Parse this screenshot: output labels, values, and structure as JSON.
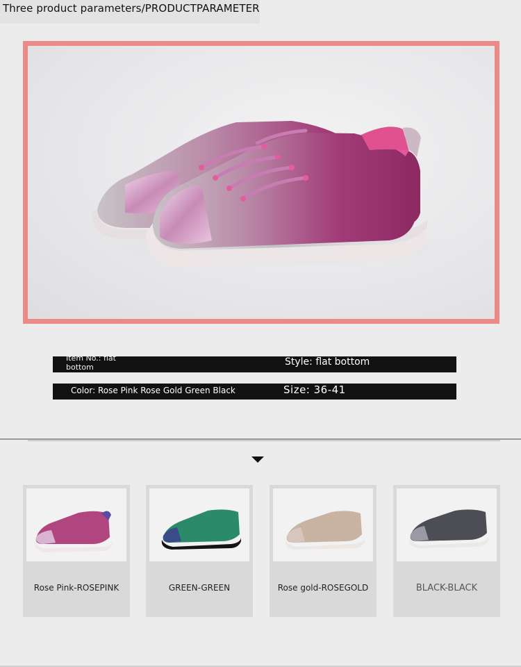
{
  "header": {
    "title": "Three product parameters/PRODUCTPARAMETER"
  },
  "hero": {
    "image_alt": "Rose pink glitter lace-up sneaker",
    "frame_color": "#ec8a89"
  },
  "parameters": {
    "item_no": "Item No.: flat bottom",
    "style": "Style: flat bottom",
    "color": "Color: Rose Pink Rose Gold Green Black",
    "size": "Size: 36-41"
  },
  "swatches": [
    {
      "label": "Rose Pink-ROSEPINK",
      "glitter": "#b0457f",
      "toe": "#d9b4d2"
    },
    {
      "label": "GREEN-GREEN",
      "glitter": "#2a8a6a",
      "toe": "#3a4a8a"
    },
    {
      "label": "Rose gold-ROSEGOLD",
      "glitter": "#c9b4a4",
      "toe": "#d7c6bd"
    },
    {
      "label": "BLACK-BLACK",
      "glitter": "#4d4d55",
      "toe": "#9a9aa4"
    }
  ]
}
